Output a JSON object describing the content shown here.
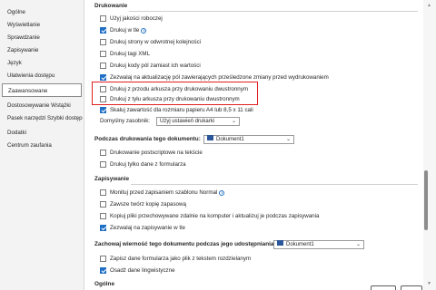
{
  "sidebar": {
    "items": [
      {
        "label": "Ogólne"
      },
      {
        "label": "Wyświetlanie"
      },
      {
        "label": "Sprawdzanie"
      },
      {
        "label": "Zapisywanie"
      },
      {
        "label": "Język"
      },
      {
        "label": "Ułatwienia dostępu"
      },
      {
        "label": "Zaawansowane",
        "active": true
      },
      {
        "label": "Dostosowywanie Wstążki"
      },
      {
        "label": "Pasek narzędzi Szybki dostęp"
      },
      {
        "label": "Dodatki"
      },
      {
        "label": "Centrum zaufania"
      }
    ]
  },
  "drukowanie": {
    "title": "Drukowanie",
    "options": [
      {
        "label": "Użyj jakości roboczej",
        "checked": false
      },
      {
        "label": "Drukuj w tle",
        "checked": true,
        "info_icon": true
      },
      {
        "label": "Drukuj strony w odwrotnej kolejności",
        "checked": false
      },
      {
        "label": "Drukuj tagi XML",
        "checked": false
      },
      {
        "label": "Drukuj kody pól zamiast ich wartości",
        "checked": false
      },
      {
        "label": "Zezwalaj na aktualizację pól zawierających prześledzone zmiany przed wydrukowaniem",
        "checked": true
      },
      {
        "label": "Drukuj z przodu arkusza przy drukowaniu dwustronnym",
        "checked": false
      },
      {
        "label": "Drukuj z tyłu arkusza przy drukowaniu dwustronnym",
        "checked": false
      },
      {
        "label": "Skaluj zawartość dla rozmiaru papieru A4 lub 8,5 x 11 cali",
        "checked": true
      }
    ],
    "default_tray_label": "Domyślny zasobnik:",
    "default_tray_value": "Użyj ustawień drukarki"
  },
  "print_doc": {
    "title": "Podczas drukowania tego dokumentu:",
    "document": "Dokument1",
    "options": [
      {
        "label": "Drukowanie postscriptowe na tekście",
        "checked": false
      },
      {
        "label": "Drukuj tylko dane z formularza",
        "checked": false
      }
    ]
  },
  "zapisywanie": {
    "title": "Zapisywanie",
    "options": [
      {
        "label": "Monituj przed zapisaniem szablonu Normal",
        "checked": false,
        "info_icon": true
      },
      {
        "label": "Zawsze twórz kopię zapasową",
        "checked": false
      },
      {
        "label": "Kopiuj pliki przechowywane zdalnie na komputer i aktualizuj je podczas zapisywania",
        "checked": false
      },
      {
        "label": "Zezwalaj na zapisywanie w tle",
        "checked": true
      }
    ]
  },
  "fidelity": {
    "title": "Zachowaj wierność tego dokumentu podczas jego udostępniania:",
    "document": "Dokument1",
    "options": [
      {
        "label": "Zapisz dane formularza jako plik z tekstem rozdzielanym",
        "checked": false
      },
      {
        "label": "Osadź dane lingwistyczne",
        "checked": true
      }
    ]
  },
  "next_section": {
    "title": "Ogólne"
  },
  "colors": {
    "accent": "#1f6fc5",
    "highlight": "#e01e1e"
  }
}
